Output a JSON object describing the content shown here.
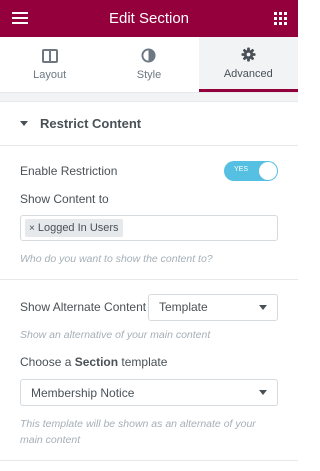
{
  "header": {
    "title": "Edit Section",
    "menu_icon": "hamburger-icon",
    "apps_icon": "grid-icon"
  },
  "tabs": [
    {
      "label": "Layout",
      "icon": "layout-columns-icon",
      "active": false
    },
    {
      "label": "Style",
      "icon": "contrast-icon",
      "active": false
    },
    {
      "label": "Advanced",
      "icon": "gear-icon",
      "active": true
    }
  ],
  "section": {
    "title": "Restrict Content"
  },
  "enable_restriction": {
    "label": "Enable Restriction",
    "toggle_text": "YES",
    "value": true
  },
  "show_content_to": {
    "label": "Show Content to",
    "tags": [
      "Logged In Users"
    ],
    "description": "Who do you want to show the content to?"
  },
  "alternate_content": {
    "label": "Show Alternate Content",
    "value": "Template",
    "description": "Show an alternative of your main content"
  },
  "choose_template": {
    "label_prefix": "Choose a",
    "label_bold": "Section",
    "label_suffix": "template",
    "value": "Membership Notice",
    "description": "This template will be shown as an alternate of your main content"
  },
  "colors": {
    "brand": "#93003c",
    "toggle_on": "#55c0e1"
  }
}
